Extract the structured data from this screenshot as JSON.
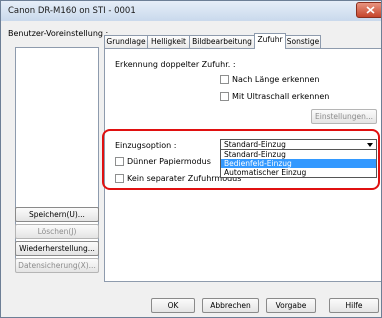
{
  "window": {
    "title": "Canon DR-M160 on STI - 0001"
  },
  "left": {
    "preset_label": "Benutzer-Voreinstellung :",
    "presets": [],
    "buttons": {
      "save": "Speichern(U)...",
      "delete": "Löschen(J)",
      "restore": "Wiederherstellung...",
      "backup": "Datensicherung(X)..."
    }
  },
  "tabs": [
    {
      "label": "Grundlage",
      "active": false
    },
    {
      "label": "Helligkeit",
      "active": false
    },
    {
      "label": "Bildbearbeitung",
      "active": false
    },
    {
      "label": "Zufuhr",
      "active": true
    },
    {
      "label": "Sonstige",
      "active": false
    }
  ],
  "feed": {
    "double_feed_label": "Erkennung doppelter Zufuhr. :",
    "by_length": "Nach Länge erkennen",
    "by_ultrasonic": "Mit Ultraschall erkennen",
    "settings_button": "Einstellungen...",
    "feeding_option_label": "Einzugsoption :",
    "selected_option": "Standard-Einzug",
    "options": [
      "Standard-Einzug",
      "Bedienfeld-Einzug",
      "Automatischer Einzug"
    ],
    "highlighted_index": 1,
    "thin_paper": "Dünner Papiermodus",
    "no_separate_feed": "Kein separater Zufuhrmodus"
  },
  "footer": {
    "ok": "OK",
    "cancel": "Abbrechen",
    "default": "Vorgabe",
    "help": "Hilfe"
  },
  "colors": {
    "highlight": "#e01010",
    "selection": "#3399ff",
    "titlebar": "#c9d9ec"
  }
}
